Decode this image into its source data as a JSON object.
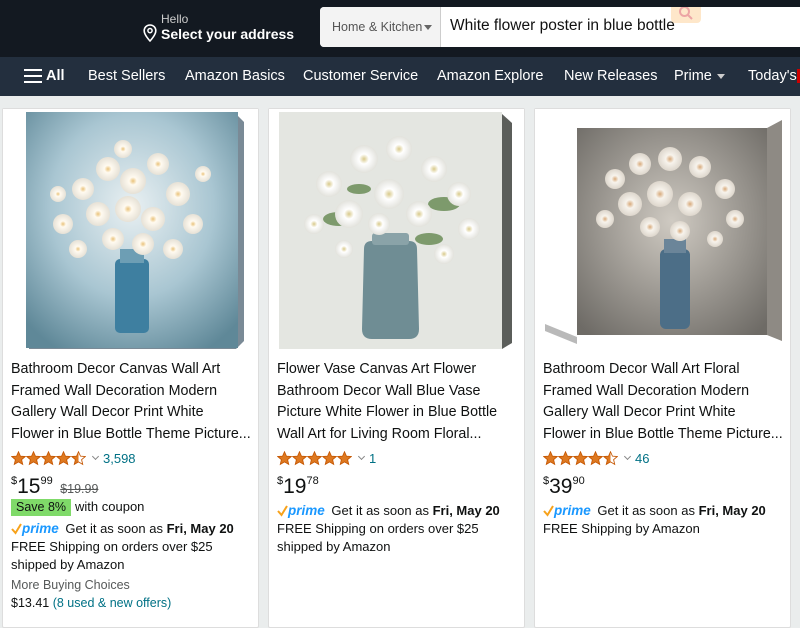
{
  "header": {
    "hello": "Hello",
    "address": "Select your address",
    "search_department": "Home & Kitchen",
    "search_query": "White flower poster in blue bottle"
  },
  "nav": {
    "all": "All",
    "items": [
      "Best Sellers",
      "Amazon Basics",
      "Customer Service",
      "Amazon Explore",
      "New Releases",
      "Prime",
      "Today's"
    ]
  },
  "products": [
    {
      "title_lines": [
        "Bathroom Decor Canvas Wall Art",
        "Framed Wall Decoration Modern",
        "Gallery Wall Decor Print White",
        "Flower in Blue Bottle Theme Picture..."
      ],
      "rating": 4.5,
      "review_count": "3,598",
      "price_symbol": "$",
      "price_whole": "15",
      "price_fraction": "99",
      "list_price": "$19.99",
      "coupon_badge": "Save 8%",
      "coupon_text": "with coupon",
      "prime_label": "prime",
      "delivery_prefix": "Get it as soon as",
      "delivery_date": "Fri, May 20",
      "shipping": "FREE Shipping on orders over $25 shipped by Amazon",
      "more_choices": "More Buying Choices",
      "offer_price": "$13.41",
      "offer_link": "(8 used & new offers)"
    },
    {
      "title_lines": [
        "Flower Vase Canvas Art Flower",
        "Bathroom Decor Wall Blue Vase",
        "Picture White Flower in Blue Bottle",
        "Wall Art for Living Room Floral..."
      ],
      "rating": 5,
      "review_count": "1",
      "price_symbol": "$",
      "price_whole": "19",
      "price_fraction": "78",
      "prime_label": "prime",
      "delivery_prefix": "Get it as soon as",
      "delivery_date": "Fri, May 20",
      "shipping": "FREE Shipping on orders over $25 shipped by Amazon"
    },
    {
      "title_lines": [
        "Bathroom Decor Wall Art Floral",
        "Framed Wall Decoration Modern",
        "Gallery Wall Decor Print White",
        "Flower in Blue Bottle Theme Picture..."
      ],
      "rating": 4.5,
      "review_count": "46",
      "price_symbol": "$",
      "price_whole": "39",
      "price_fraction": "90",
      "prime_label": "prime",
      "delivery_prefix": "Get it as soon as",
      "delivery_date": "Fri, May 20",
      "shipping": "FREE Shipping by Amazon"
    }
  ],
  "colors": {
    "header_bg": "#131921",
    "nav_bg": "#232f3e",
    "link": "#007185",
    "star": "#de7921",
    "prime": "#1a98ff",
    "coupon": "#7fda69"
  },
  "icons": [
    "location-pin-icon",
    "search-icon",
    "hamburger-menu-icon",
    "star-icon",
    "prime-check-icon",
    "chevron-down-icon"
  ]
}
